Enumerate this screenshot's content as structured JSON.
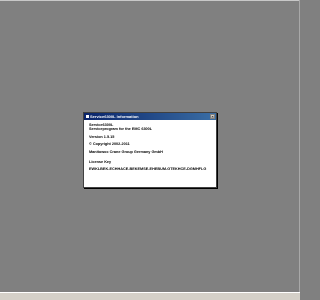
{
  "desktop": {
    "background_color": "#808080"
  },
  "dialog": {
    "title": "Service6300L Information",
    "close_glyph": "×",
    "product_name": "Service6300L",
    "description": "Serviceprogram for the EMC 6300L",
    "version": "Version 1.5.15",
    "copyright": "© Copyright 2002-2011",
    "company": "Manitowoc Crane Group Germany GmbH",
    "license_label": "License Key",
    "license_key": "EWKLBEK-ECHHACE-BEKEMSE-EHEBUM-GTEKHCE-DGMHFLG"
  }
}
